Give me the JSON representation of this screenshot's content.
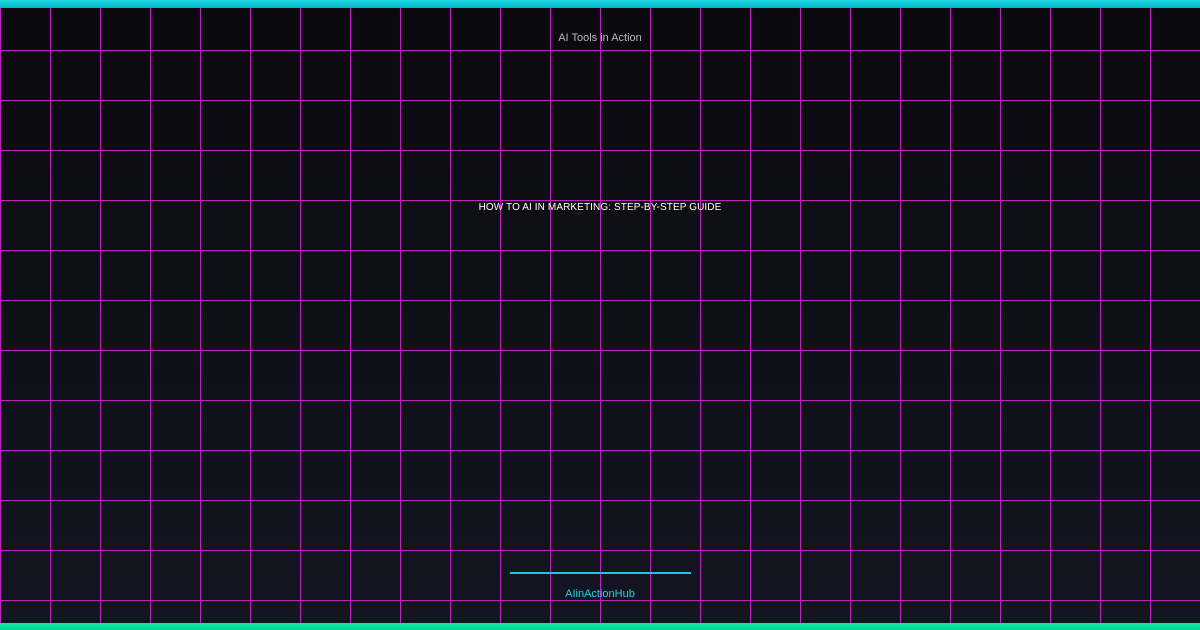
{
  "header": {
    "eyebrow": "AI Tools in Action"
  },
  "main": {
    "title": "HOW TO AI IN MARKETING: STEP-BY-STEP GUIDE"
  },
  "footer": {
    "brand": "AIinActionHub"
  },
  "colors": {
    "grid": "#c425c8",
    "top_bar": "#04b6c7",
    "bottom_bar": "#00d895",
    "accent_line": "#16c6e6",
    "brand_text": "#23d2e6",
    "title_text": "#ffffff",
    "eyebrow_text": "#b7b7c2",
    "background": "#101019"
  }
}
